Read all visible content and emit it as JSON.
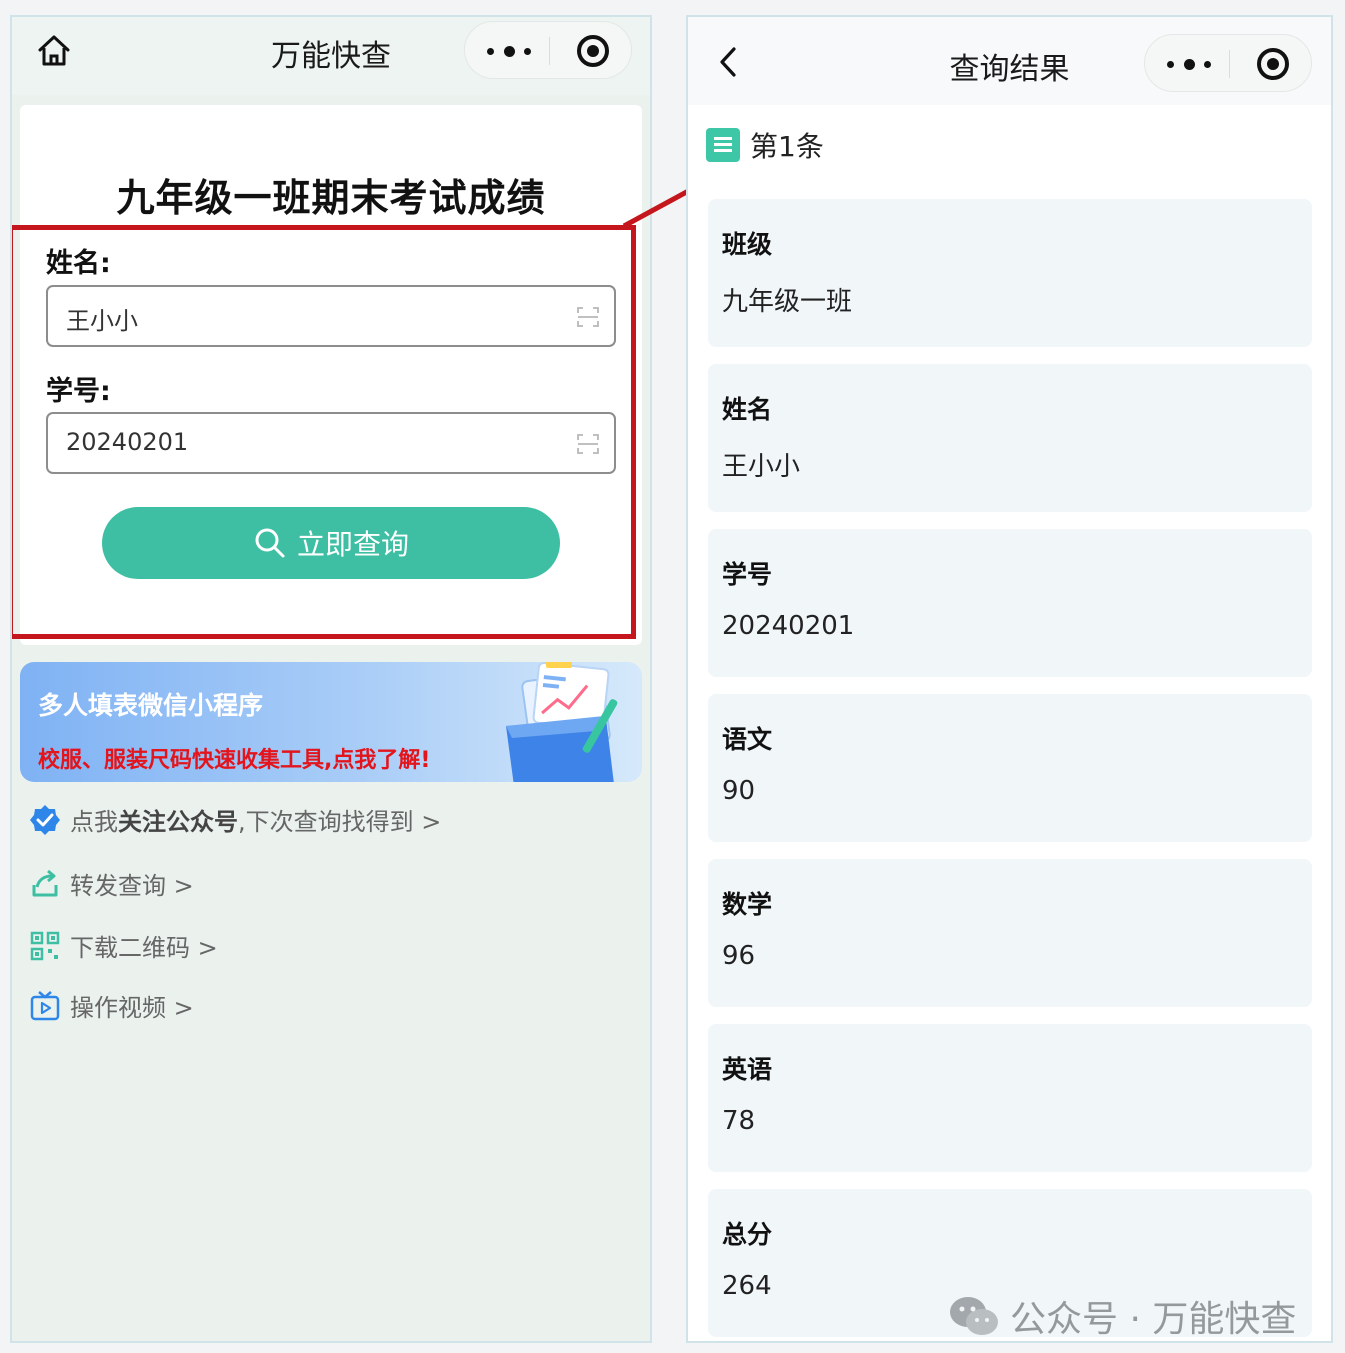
{
  "left": {
    "nav": {
      "title": "万能快查"
    },
    "form": {
      "title": "九年级一班期末考试成绩",
      "name_label": "姓名:",
      "name_value": "王小小",
      "id_label": "学号:",
      "id_value": "20240201",
      "submit_label": "立即查询"
    },
    "banner": {
      "line1": "多人填表微信小程序",
      "line2": "校服、服装尺码快速收集工具,点我了解!"
    },
    "links": [
      {
        "pre": "点我",
        "bold": "关注公众号",
        "post": ",下次查询找得到 >",
        "icon": "verified-badge-icon"
      },
      {
        "label": "转发查询 >",
        "icon": "share-icon"
      },
      {
        "label": "下载二维码 >",
        "icon": "qr-code-icon"
      },
      {
        "label": "操作视频 >",
        "icon": "video-icon"
      }
    ]
  },
  "right": {
    "nav": {
      "title": "查询结果"
    },
    "item_title": "第1条",
    "fields": [
      {
        "label": "班级",
        "value": "九年级一班"
      },
      {
        "label": "姓名",
        "value": "王小小"
      },
      {
        "label": "学号",
        "value": "20240201"
      },
      {
        "label": "语文",
        "value": "90"
      },
      {
        "label": "数学",
        "value": "96"
      },
      {
        "label": "英语",
        "value": "78"
      },
      {
        "label": "总分",
        "value": "264"
      }
    ]
  },
  "watermark": "公众号 · 万能快查",
  "colors": {
    "accent": "#3ebfa3",
    "highlight_box": "#c4161c",
    "banner_red": "#e3141c",
    "link_blue": "#2d86e8"
  }
}
